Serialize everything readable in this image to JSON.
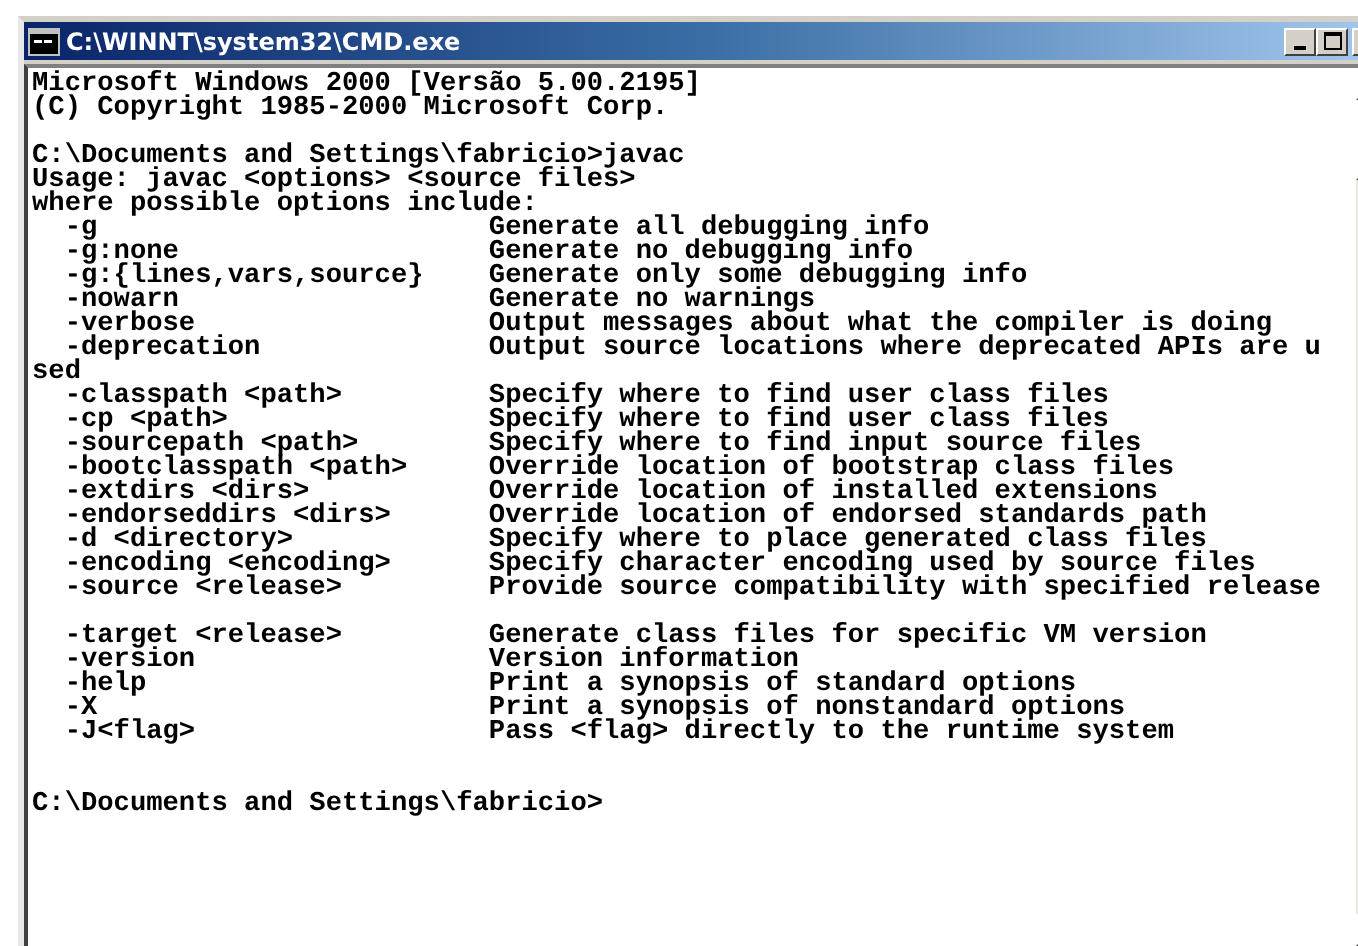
{
  "window": {
    "title": "C:\\WINNT\\system32\\CMD.exe"
  },
  "console": [
    {
      "kind": "text",
      "text": "Microsoft Windows 2000 [Versão 5.00.2195]"
    },
    {
      "kind": "text",
      "text": "(C) Copyright 1985-2000 Microsoft Corp."
    },
    {
      "kind": "blank"
    },
    {
      "kind": "text",
      "text": "C:\\Documents and Settings\\fabricio>javac"
    },
    {
      "kind": "text",
      "text": "Usage: javac <options> <source files>"
    },
    {
      "kind": "text",
      "text": "where possible options include:"
    },
    {
      "kind": "text",
      "text": "  -g                        Generate all debugging info"
    },
    {
      "kind": "text",
      "text": "  -g:none                   Generate no debugging info"
    },
    {
      "kind": "text",
      "text": "  -g:{lines,vars,source}    Generate only some debugging info"
    },
    {
      "kind": "text",
      "text": "  -nowarn                   Generate no warnings"
    },
    {
      "kind": "text",
      "text": "  -verbose                  Output messages about what the compiler is doing"
    },
    {
      "kind": "text",
      "text": "  -deprecation              Output source locations where deprecated APIs are u"
    },
    {
      "kind": "text",
      "text": "sed"
    },
    {
      "kind": "text",
      "text": "  -classpath <path>         Specify where to find user class files"
    },
    {
      "kind": "text",
      "text": "  -cp <path>                Specify where to find user class files"
    },
    {
      "kind": "text",
      "text": "  -sourcepath <path>        Specify where to find input source files"
    },
    {
      "kind": "text",
      "text": "  -bootclasspath <path>     Override location of bootstrap class files"
    },
    {
      "kind": "text",
      "text": "  -extdirs <dirs>           Override location of installed extensions"
    },
    {
      "kind": "text",
      "text": "  -endorseddirs <dirs>      Override location of endorsed standards path"
    },
    {
      "kind": "text",
      "text": "  -d <directory>            Specify where to place generated class files"
    },
    {
      "kind": "text",
      "text": "  -encoding <encoding>      Specify character encoding used by source files"
    },
    {
      "kind": "text",
      "text": "  -source <release>         Provide source compatibility with specified release"
    },
    {
      "kind": "blank"
    },
    {
      "kind": "text",
      "text": "  -target <release>         Generate class files for specific VM version"
    },
    {
      "kind": "text",
      "text": "  -version                  Version information"
    },
    {
      "kind": "text",
      "text": "  -help                     Print a synopsis of standard options"
    },
    {
      "kind": "text",
      "text": "  -X                        Print a synopsis of nonstandard options"
    },
    {
      "kind": "text",
      "text": "  -J<flag>                  Pass <flag> directly to the runtime system"
    },
    {
      "kind": "blank"
    },
    {
      "kind": "blank"
    },
    {
      "kind": "text",
      "text": "C:\\Documents and Settings\\fabricio>"
    }
  ]
}
